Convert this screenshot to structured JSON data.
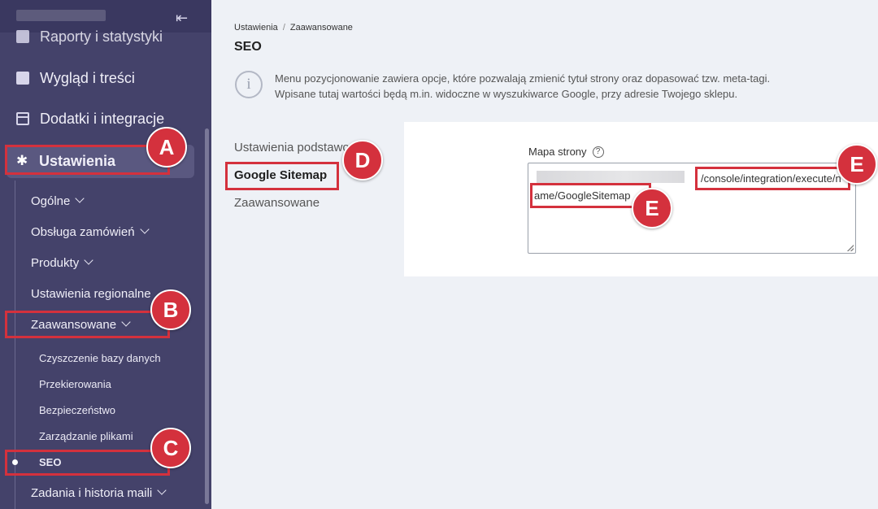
{
  "sidebar": {
    "items": [
      {
        "label": "Raporty i statystyki"
      },
      {
        "label": "Wygląd i treści"
      },
      {
        "label": "Dodatki i integracje"
      },
      {
        "label": "Ustawienia"
      }
    ],
    "sub_items": [
      {
        "label": "Ogólne"
      },
      {
        "label": "Obsługa zamówień"
      },
      {
        "label": "Produkty"
      },
      {
        "label": "Ustawienia regionalne"
      },
      {
        "label": "Zaawansowane"
      }
    ],
    "advanced_items": [
      {
        "label": "Czyszczenie bazy danych"
      },
      {
        "label": "Przekierowania"
      },
      {
        "label": "Bezpieczeństwo"
      },
      {
        "label": "Zarządzanie plikami"
      },
      {
        "label": "SEO"
      }
    ],
    "last_item": {
      "label": "Zadania i historia maili"
    }
  },
  "breadcrumb": {
    "part1": "Ustawienia",
    "separator": "/",
    "part2": "Zaawansowane"
  },
  "page_title": "SEO",
  "info": {
    "line1": "Menu pozycjonowanie zawiera opcje, które pozwalają zmienić tytuł strony oraz dopasować tzw. meta-tagi.",
    "line2": "Wpisane tutaj wartości będą m.in. widoczne w wyszukiwarce Google, przy adresie Twojego sklepu."
  },
  "tabs": [
    {
      "label": "Ustawienia podstawowe"
    },
    {
      "label": "Google Sitemap"
    },
    {
      "label": "Zaawansowane"
    }
  ],
  "field": {
    "label": "Mapa strony",
    "help": "?",
    "value_line1": "/console/integration/execute/n",
    "value_line2": "ame/GoogleSitemap"
  },
  "annotations": {
    "a": "A",
    "b": "B",
    "c": "C",
    "d": "D",
    "e1": "E",
    "e2": "E"
  },
  "colors": {
    "sidebar": "#44426a",
    "highlight": "#d4313d",
    "content_bg": "#eef1f6"
  }
}
